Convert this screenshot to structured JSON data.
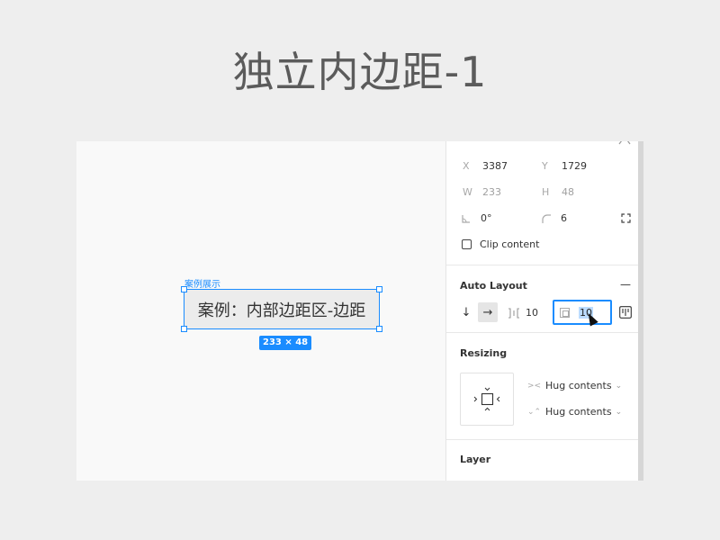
{
  "slide": {
    "title": "独立内边距-1"
  },
  "canvas": {
    "frame_label": "案例展示",
    "frame_text": "案例：内部边距区-边距",
    "size_badge": "233 × 48"
  },
  "panel": {
    "x": {
      "label": "X",
      "value": "3387"
    },
    "y": {
      "label": "Y",
      "value": "1729"
    },
    "w": {
      "label": "W",
      "value": "233"
    },
    "h": {
      "label": "H",
      "value": "48"
    },
    "rotation": {
      "value": "0°"
    },
    "radius": {
      "value": "6"
    },
    "clip_content": "Clip content",
    "auto_layout": {
      "title": "Auto Layout",
      "remove": "—",
      "vertical": "↓",
      "horizontal": "→",
      "spacing": "10",
      "padding": "10"
    },
    "resizing": {
      "title": "Resizing",
      "horizontal": "Hug contents",
      "vertical": "Hug contents"
    },
    "layer": {
      "title": "Layer"
    }
  }
}
